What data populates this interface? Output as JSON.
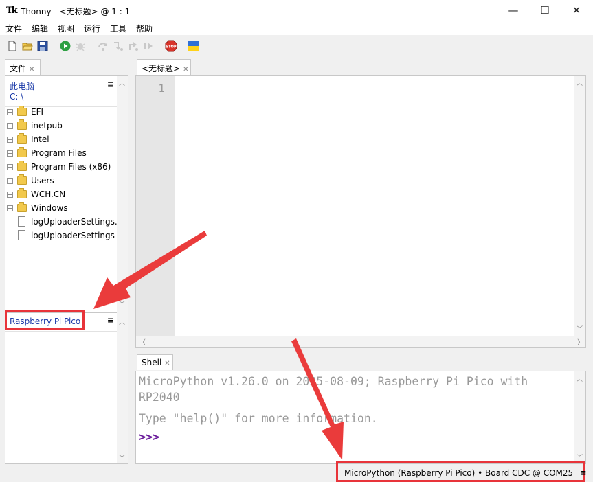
{
  "window": {
    "app_icon": "Tk",
    "title": "Thonny  -  <无标题>  @  1 : 1",
    "minimize": "—",
    "maximize": "☐",
    "close": "✕"
  },
  "menu": [
    "文件",
    "编辑",
    "视图",
    "运行",
    "工具",
    "帮助"
  ],
  "toolbar": {
    "icons": [
      "new-file-icon",
      "open-file-icon",
      "save-icon",
      "run-icon",
      "debug-icon",
      "step-over-icon",
      "step-into-icon",
      "step-out-icon",
      "resume-icon",
      "stop-icon",
      "ukraine-flag-icon"
    ],
    "stop_label": "STOP"
  },
  "files_panel": {
    "tab_label": "文件",
    "this_pc": "此电脑",
    "path": "C: \\",
    "menu_glyph": "≡",
    "items": [
      {
        "name": "EFI",
        "type": "folder"
      },
      {
        "name": "inetpub",
        "type": "folder"
      },
      {
        "name": "Intel",
        "type": "folder"
      },
      {
        "name": "Program Files",
        "type": "folder"
      },
      {
        "name": "Program Files (x86)",
        "type": "folder"
      },
      {
        "name": "Users",
        "type": "folder"
      },
      {
        "name": "WCH.CN",
        "type": "folder"
      },
      {
        "name": "Windows",
        "type": "folder"
      },
      {
        "name": "logUploaderSettings.i",
        "type": "file"
      },
      {
        "name": "logUploaderSettings_t",
        "type": "file"
      }
    ],
    "device_label": "Raspberry Pi Pico",
    "device_menu_glyph": "≡"
  },
  "editor": {
    "tab_label": "<无标题>",
    "line_number": "1"
  },
  "shell": {
    "tab_label": "Shell",
    "banner_line1": "MicroPython v1.26.0 on 2025-08-09; Raspberry Pi Pico with",
    "banner_line2": "RP2040",
    "help_line": "Type \"help()\" for more information.",
    "prompt": ">>>"
  },
  "status": {
    "interpreter": "MicroPython (Raspberry Pi Pico)  •  Board CDC @ COM25",
    "menu_glyph": "≡"
  },
  "colors": {
    "highlight": "#e8343a",
    "link_blue": "#1a3aa8",
    "prompt_purple": "#6b1c9c"
  }
}
